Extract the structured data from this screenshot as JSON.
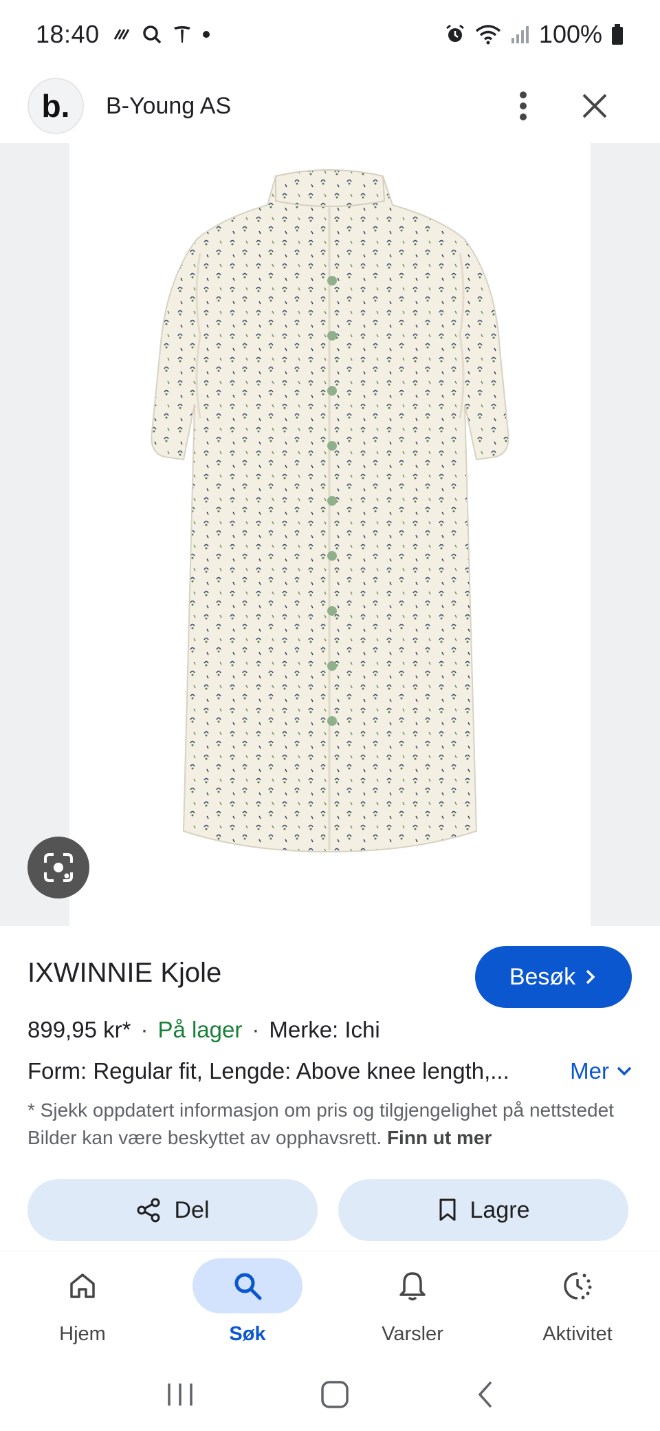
{
  "status_bar": {
    "time": "18:40",
    "battery_percent": "100%"
  },
  "header": {
    "logo_text": "b.",
    "site_name": "B-Young AS"
  },
  "product": {
    "title": "IXWINNIE Kjole",
    "visit_label": "Besøk",
    "price": "899,95 kr*",
    "availability": "På lager",
    "brand": "Merke: Ichi",
    "description": "Form: Regular fit, Lengde: Above knee length,...",
    "more_label": "Mer",
    "disclaimer": "* Sjekk oppdatert informasjon om pris og tilgjengelighet på nettstedet Bilder kan være beskyttet av opphavsrett.",
    "disclaimer_link": "Finn ut mer"
  },
  "actions": {
    "share_label": "Del",
    "save_label": "Lagre"
  },
  "bottom_nav": {
    "items": [
      {
        "label": "Hjem",
        "icon": "home-icon"
      },
      {
        "label": "Søk",
        "icon": "search-icon",
        "active": true
      },
      {
        "label": "Varsler",
        "icon": "bell-icon"
      },
      {
        "label": "Aktivitet",
        "icon": "activity-icon"
      }
    ]
  },
  "colors": {
    "accent": "#0b57d0",
    "in_stock": "#188038",
    "chip_bg": "#dfeaf8",
    "dress": "#f3efe3"
  }
}
